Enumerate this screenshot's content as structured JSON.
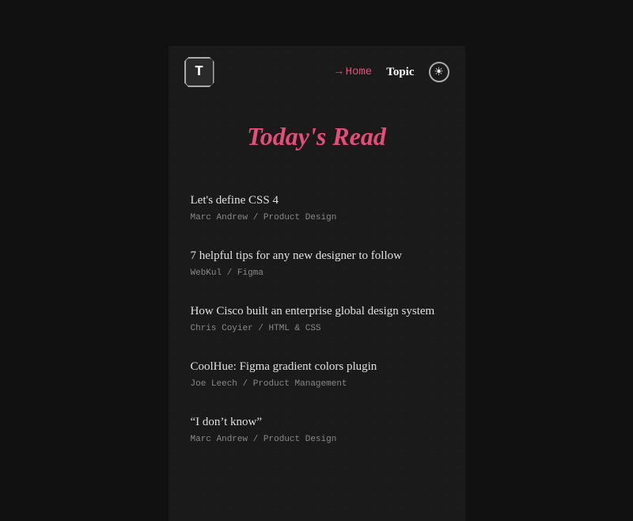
{
  "app": {
    "logo_letter": "T"
  },
  "header": {
    "home_arrow": "→",
    "home_label": "Home",
    "topic_label": "Topic",
    "theme_icon": "☀"
  },
  "main": {
    "page_title": "Today's Read",
    "articles": [
      {
        "title": "Let's define CSS 4",
        "meta": "Marc Andrew / Product Design"
      },
      {
        "title": "7 helpful tips for any new designer to follow",
        "meta": "WebKul / Figma"
      },
      {
        "title": "How Cisco built an enterprise global design system",
        "meta": "Chris Coyier / HTML & CSS"
      },
      {
        "title": "CoolHue: Figma gradient colors plugin",
        "meta": "Joe Leech / Product Management"
      },
      {
        "title": "“I don’t know”",
        "meta": "Marc Andrew / Product Design"
      }
    ]
  }
}
